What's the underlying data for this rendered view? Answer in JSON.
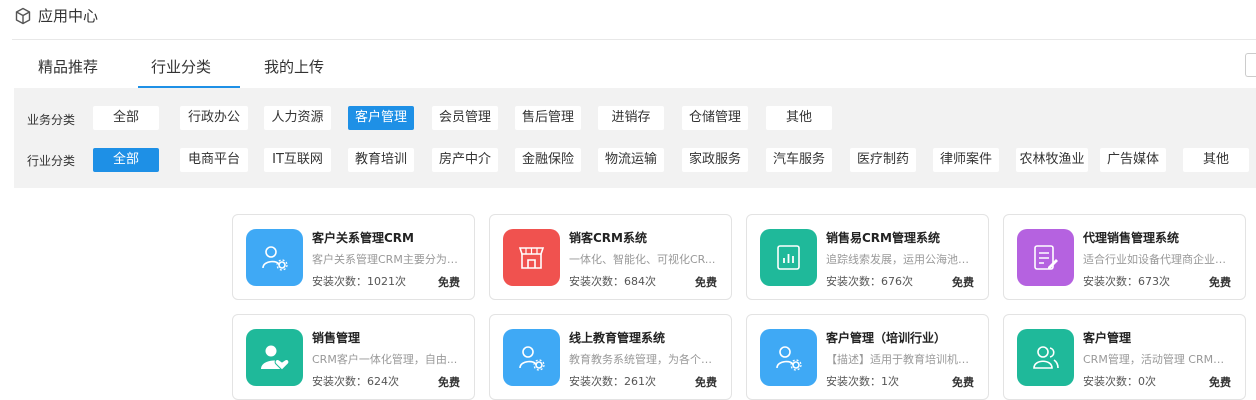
{
  "header": {
    "title": "应用中心"
  },
  "tabs": [
    {
      "label": "精品推荐"
    },
    {
      "label": "行业分类"
    },
    {
      "label": "我的上传"
    }
  ],
  "filters": {
    "business": {
      "label": "业务分类",
      "items": [
        "全部",
        "行政办公",
        "人力资源",
        "客户管理",
        "会员管理",
        "售后管理",
        "进销存",
        "仓储管理",
        "其他"
      ],
      "selected": "客户管理"
    },
    "industry": {
      "label": "行业分类",
      "items": [
        "全部",
        "电商平台",
        "IT互联网",
        "教育培训",
        "房产中介",
        "金融保险",
        "物流运输",
        "家政服务",
        "汽车服务",
        "医疗制药",
        "律师案件",
        "农林牧渔业",
        "广告媒体",
        "其他"
      ],
      "selected": "全部"
    }
  },
  "apps": [
    {
      "name": "客户关系管理CRM",
      "desc": "客户关系管理CRM主要分为4...",
      "installs": "安装次数：1021次",
      "price": "免费",
      "icon": "user-gear-icon",
      "color": "#3fa9f5"
    },
    {
      "name": "销客CRM系统",
      "desc": "一体化、智能化、可视化CR...",
      "installs": "安装次数：684次",
      "price": "免费",
      "icon": "store-icon",
      "color": "#f0524f"
    },
    {
      "name": "销售易CRM管理系统",
      "desc": "追踪线索发展，运用公海池提...",
      "installs": "安装次数：676次",
      "price": "免费",
      "icon": "report-icon",
      "color": "#1fb99a"
    },
    {
      "name": "代理销售管理系统",
      "desc": "适合行业如设备代理商企业，...",
      "installs": "安装次数：673次",
      "price": "免费",
      "icon": "document-edit-icon",
      "color": "#b562e0"
    },
    {
      "name": "销售管理",
      "desc": "CRM客户一体化管理，自由...",
      "installs": "安装次数：624次",
      "price": "免费",
      "icon": "user-heart-icon",
      "color": "#1fb99a"
    },
    {
      "name": "线上教育管理系统",
      "desc": "教育教务系统管理，为各个学...",
      "installs": "安装次数：261次",
      "price": "免费",
      "icon": "user-gear-icon",
      "color": "#3fa9f5"
    },
    {
      "name": "客户管理（培训行业）",
      "desc": "【描述】适用于教育培训机构...",
      "installs": "安装次数：1次",
      "price": "免费",
      "icon": "user-gear-icon",
      "color": "#3fa9f5"
    },
    {
      "name": "客户管理",
      "desc": "CRM管理，活动管理 CRM客...",
      "installs": "安装次数：0次",
      "price": "免费",
      "icon": "users-icon",
      "color": "#1fb99a"
    }
  ]
}
